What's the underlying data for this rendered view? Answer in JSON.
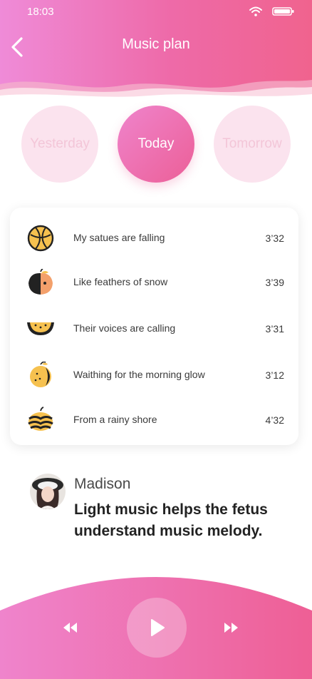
{
  "status_bar": {
    "time": "18:03",
    "icons": [
      "wifi-icon",
      "battery-icon"
    ]
  },
  "header": {
    "title": "Music plan",
    "back_icon": "chevron-left-icon"
  },
  "days": [
    {
      "label": "Yesterday",
      "selected": false
    },
    {
      "label": "Today",
      "selected": true
    },
    {
      "label": "Tomorrow",
      "selected": false
    }
  ],
  "songs": [
    {
      "title": "My satues are falling",
      "duration": "3’32",
      "icon": "basketball-fruit-icon"
    },
    {
      "title": "Like feathers of snow",
      "duration": "3’39",
      "icon": "half-apple-icon"
    },
    {
      "title": "Their voices are calling",
      "duration": "3’31",
      "icon": "watermelon-slice-icon"
    },
    {
      "title": "Waithing for the morning glow",
      "duration": "3’12",
      "icon": "kiwi-fruit-icon"
    },
    {
      "title": "From a rainy shore",
      "duration": "4’32",
      "icon": "pumpkin-icon"
    }
  ],
  "comment": {
    "author": "Madison",
    "text": "Light music helps the fetus understand music melody."
  },
  "player": {
    "rewind_icon": "rewind-icon",
    "play_icon": "play-icon",
    "forward_icon": "fast-forward-icon"
  },
  "colors": {
    "accent_light": "#ef8bd8",
    "accent": "#ec5f97",
    "day_inactive_bg": "#fbe3ee",
    "icon_yellow": "#f6c14f",
    "icon_dark": "#222222"
  }
}
